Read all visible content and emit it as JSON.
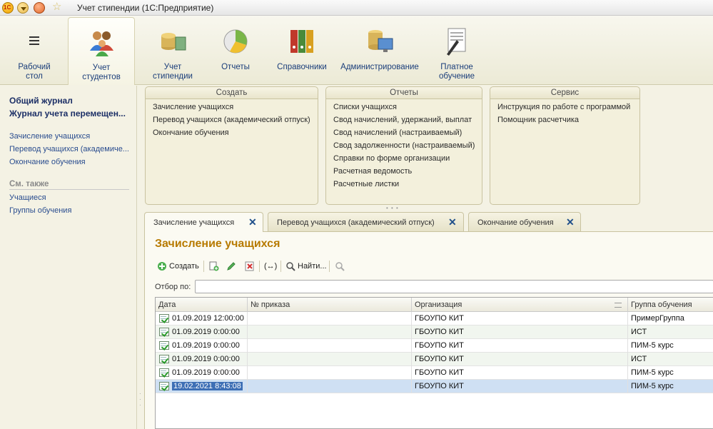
{
  "window": {
    "title": "Учет стипендии  (1С:Предприятие)"
  },
  "sections": [
    {
      "label": "Рабочий\nстол",
      "line1": "Рабочий",
      "line2": "стол",
      "icon": "menu-lines-icon"
    },
    {
      "line1": "Учет",
      "line2": "студентов",
      "icon": "people-icon"
    },
    {
      "line1": "Учет",
      "line2": "стипендии",
      "icon": "coins-icon"
    },
    {
      "line1": "Отчеты",
      "line2": "",
      "icon": "pie-chart-icon"
    },
    {
      "line1": "Справочники",
      "line2": "",
      "icon": "binders-icon"
    },
    {
      "line1": "Администрирование",
      "line2": "",
      "icon": "database-monitor-icon"
    },
    {
      "line1": "Платное",
      "line2": "обучение",
      "icon": "contract-pen-icon"
    }
  ],
  "leftnav": {
    "main": [
      "Общий журнал",
      "Журнал учета перемещен..."
    ],
    "links": [
      "Зачисление учащихся",
      "Перевод учащихся (академиче...",
      "Окончание обучения"
    ],
    "see_also_title": "См. также",
    "see_also": [
      "Учащиеся",
      "Группы обучения"
    ]
  },
  "groups": {
    "create": {
      "title": "Создать",
      "items": [
        "Зачисление учащихся",
        "Перевод учащихся (академический отпуск)",
        "Окончание обучения"
      ]
    },
    "reports": {
      "title": "Отчеты",
      "items": [
        "Списки учащихся",
        "Свод начислений, удержаний, выплат",
        "Свод начислений (настраиваемый)",
        "Свод задолженности (настраиваемый)",
        "Справки по форме организации",
        "Расчетная ведомость",
        "Расчетные листки"
      ]
    },
    "service": {
      "title": "Сервис",
      "items": [
        "Инструкция по работе с программой",
        "Помощник расчетчика"
      ]
    }
  },
  "tabs": [
    {
      "label": "Зачисление учащихся",
      "active": true
    },
    {
      "label": "Перевод учащихся (академический отпуск)",
      "active": false
    },
    {
      "label": "Окончание обучения",
      "active": false
    }
  ],
  "form": {
    "title": "Зачисление учащихся",
    "toolbar": {
      "create": "Создать",
      "find": "Найти...",
      "interval": "(↔)"
    },
    "filter_label": "Отбор по:",
    "filter_value": ""
  },
  "table": {
    "columns": [
      "Дата",
      "№ приказа",
      "Организация",
      "Группа обучения"
    ],
    "rows": [
      {
        "date": "01.09.2019 12:00:00",
        "order": "",
        "org": "ГБОУПО КИТ",
        "group": "ПримерГруппа"
      },
      {
        "date": "01.09.2019 0:00:00",
        "order": "",
        "org": "ГБОУПО КИТ",
        "group": "ИСТ"
      },
      {
        "date": "01.09.2019 0:00:00",
        "order": "",
        "org": "ГБОУПО КИТ",
        "group": "ПИМ-5 курс"
      },
      {
        "date": "01.09.2019 0:00:00",
        "order": "",
        "org": "ГБОУПО КИТ",
        "group": "ИСТ"
      },
      {
        "date": "01.09.2019 0:00:00",
        "order": "",
        "org": "ГБОУПО КИТ",
        "group": "ПИМ-5 курс"
      },
      {
        "date": "19.02.2021 8:43:08",
        "order": "",
        "org": "ГБОУПО КИТ",
        "group": "ПИМ-5 курс"
      }
    ],
    "selected_row": 6
  }
}
